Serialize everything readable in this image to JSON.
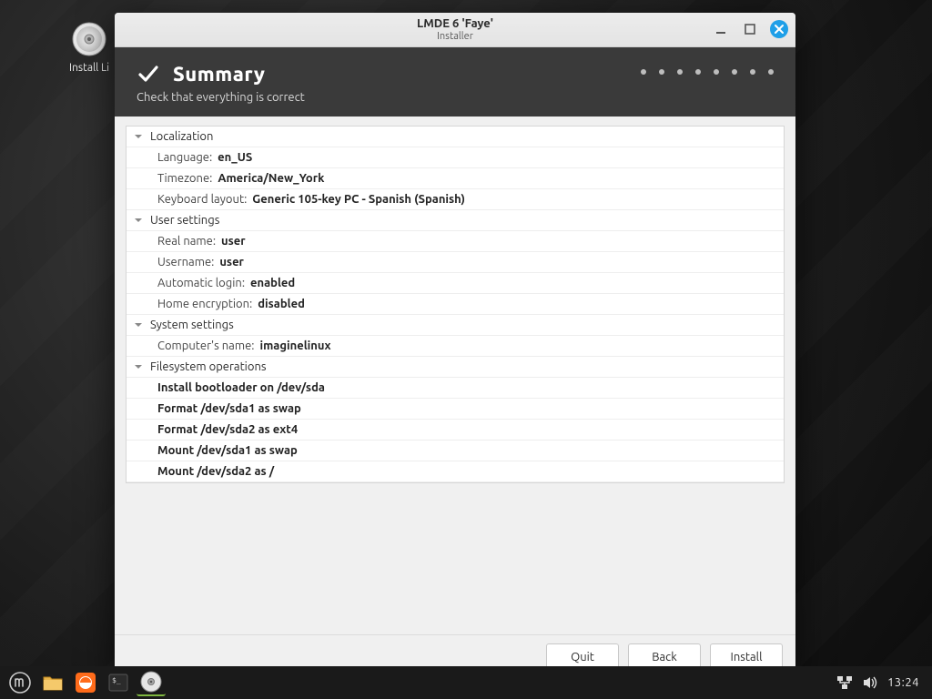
{
  "desktop": {
    "install_label": "Install Li"
  },
  "window": {
    "title": "LMDE 6 'Faye'",
    "subtitle": "Installer",
    "minimize_name": "minimize-button",
    "maximize_name": "maximize-button",
    "close_name": "close-button"
  },
  "header": {
    "title": "Summary",
    "subtitle": "Check that everything is correct"
  },
  "sections": {
    "localization": {
      "title": "Localization",
      "language_label": "Language: ",
      "language_value": "en_US",
      "timezone_label": "Timezone: ",
      "timezone_value": "America/New_York",
      "keyboard_label": "Keyboard layout: ",
      "keyboard_value": "Generic 105-key PC - Spanish (Spanish)"
    },
    "user": {
      "title": "User settings",
      "realname_label": "Real name: ",
      "realname_value": "user",
      "username_label": "Username: ",
      "username_value": "user",
      "autologin_label": "Automatic login: ",
      "autologin_value": "enabled",
      "homeenc_label": "Home encryption: ",
      "homeenc_value": "disabled"
    },
    "system": {
      "title": "System settings",
      "hostname_label": "Computer's name: ",
      "hostname_value": "imaginelinux"
    },
    "fs": {
      "title": "Filesystem operations",
      "ops": [
        "Install bootloader on /dev/sda",
        "Format /dev/sda1 as swap",
        "Format /dev/sda2 as ext4",
        "Mount /dev/sda1 as swap",
        "Mount /dev/sda2 as /"
      ]
    }
  },
  "footer": {
    "quit": "Quit",
    "back": "Back",
    "install": "Install"
  },
  "panel": {
    "clock": "13:24"
  }
}
